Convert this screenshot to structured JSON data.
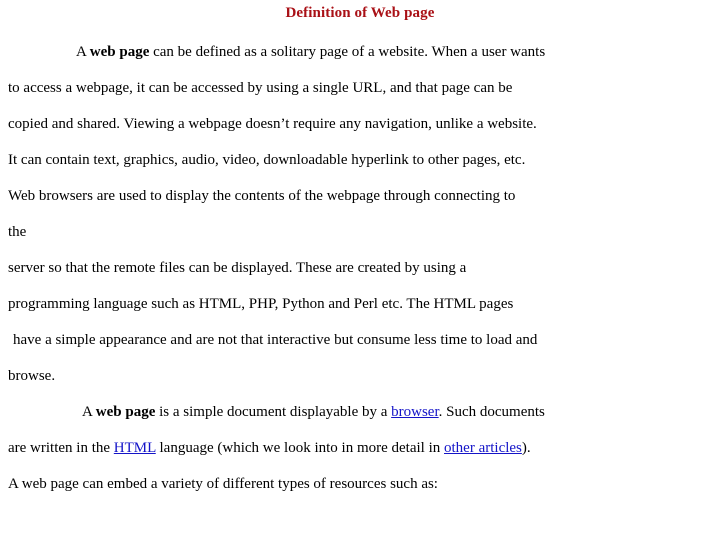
{
  "slide": {
    "title": "Definition of Web page",
    "title_color": "#A91016",
    "link_color": "#1414C8",
    "background": "#ffffff",
    "paragraph_1": {
      "lines": [
        {
          "id": "p1l1",
          "indent": "indent-1",
          "segments": [
            {
              "text": "A ",
              "style": "normal"
            },
            {
              "text": "web page",
              "style": "bold"
            },
            {
              "text": " can be defined as a solitary page of a website. When a user wants",
              "style": "normal"
            }
          ]
        },
        {
          "id": "p1l2",
          "indent": "none",
          "segments": [
            {
              "text": "to access a webpage, it can be accessed by using a single URL, and that page can be",
              "style": "normal"
            }
          ]
        },
        {
          "id": "p1l3",
          "indent": "none",
          "segments": [
            {
              "text": "copied and shared. Viewing a webpage doesn’t require any navigation, unlike a website.",
              "style": "normal"
            }
          ]
        },
        {
          "id": "p1l4",
          "indent": "none",
          "segments": [
            {
              "text": "It can contain text, graphics, audio, video, downloadable hyperlink to other pages, etc.",
              "style": "normal"
            }
          ]
        },
        {
          "id": "p1l5",
          "indent": "none",
          "segments": [
            {
              "text": "Web browsers are used to display the contents of the webpage through connecting to",
              "style": "normal"
            }
          ]
        },
        {
          "id": "p1l6",
          "indent": "none",
          "segments": [
            {
              "text": "the",
              "style": "normal"
            }
          ]
        },
        {
          "id": "p1l7",
          "indent": "none",
          "segments": [
            {
              "text": "server so that the remote files can be displayed. These are created by using a",
              "style": "normal"
            }
          ]
        },
        {
          "id": "p1l8",
          "indent": "none",
          "segments": [
            {
              "text": "programming language such as HTML, PHP, Python and Perl etc. The HTML pages",
              "style": "normal"
            }
          ]
        },
        {
          "id": "p1l9",
          "indent": "pad-sm",
          "segments": [
            {
              "text": "have a simple appearance and are not that interactive but consume less time to load and",
              "style": "normal"
            }
          ]
        },
        {
          "id": "p1l10",
          "indent": "none",
          "segments": [
            {
              "text": "browse.",
              "style": "normal"
            }
          ]
        }
      ]
    },
    "paragraph_2": {
      "lines": [
        {
          "id": "p2l1",
          "indent": "indent-2",
          "segments": [
            {
              "text": "A ",
              "style": "normal"
            },
            {
              "text": "web page",
              "style": "bold"
            },
            {
              "text": " is a simple document displayable by a ",
              "style": "normal"
            },
            {
              "text": "browser",
              "style": "link"
            },
            {
              "text": ". Such documents",
              "style": "normal"
            }
          ]
        },
        {
          "id": "p2l2",
          "indent": "none",
          "segments": [
            {
              "text": "are written in the ",
              "style": "normal"
            },
            {
              "text": "HTML",
              "style": "link"
            },
            {
              "text": " language (which we look into in more detail in ",
              "style": "normal"
            },
            {
              "text": "other articles",
              "style": "link"
            },
            {
              "text": ").",
              "style": "normal"
            }
          ]
        },
        {
          "id": "p2l3",
          "indent": "none",
          "segments": [
            {
              "text": "A web page can embed a variety of different types of resources such as:",
              "style": "normal"
            }
          ]
        }
      ]
    }
  }
}
